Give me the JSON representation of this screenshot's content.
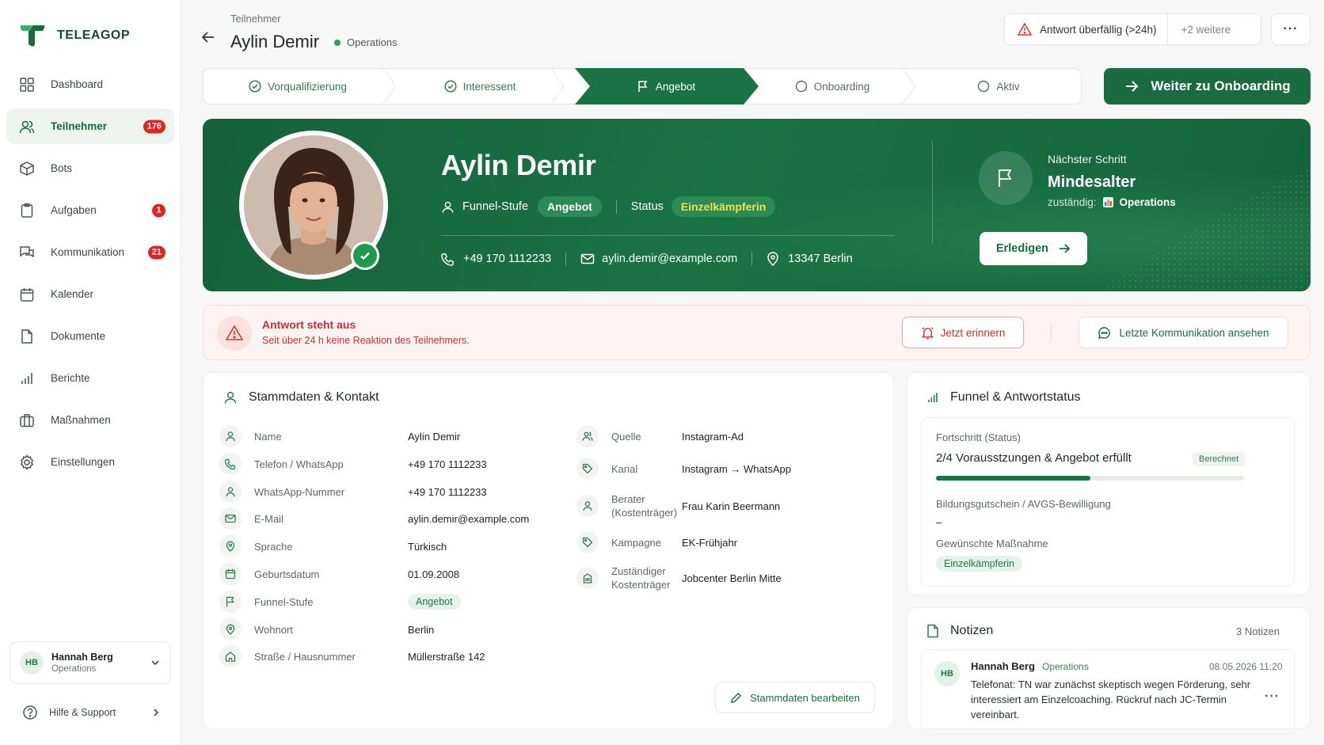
{
  "brand": {
    "name": "TELEAGOP"
  },
  "sidebar": {
    "items": [
      {
        "label": "Dashboard",
        "icon": "dashboard-icon"
      },
      {
        "label": "Teilnehmer",
        "icon": "users-icon",
        "badge": "176",
        "active": true
      },
      {
        "label": "Bots",
        "icon": "bot-icon"
      },
      {
        "label": "Aufgaben",
        "icon": "clipboard-icon",
        "badge": "1"
      },
      {
        "label": "Kommunikation",
        "icon": "chat-icon",
        "badge": "21"
      },
      {
        "label": "Kalender",
        "icon": "calendar-icon"
      },
      {
        "label": "Dokumente",
        "icon": "document-icon"
      },
      {
        "label": "Berichte",
        "icon": "bar-chart-icon"
      },
      {
        "label": "Maßnahmen",
        "icon": "briefcase-icon"
      },
      {
        "label": "Einstellungen",
        "icon": "gear-icon"
      }
    ],
    "user": {
      "initials": "HB",
      "name": "Hannah Berg",
      "role": "Operations"
    },
    "help": "Hilfe & Support"
  },
  "header": {
    "breadcrumb": "Teilnehmer",
    "title": "Aylin Demir",
    "team": "Operations",
    "alert": "Antwort überfällig (>24h)",
    "alert_more": "+2 weitere",
    "more": "···"
  },
  "steps": [
    {
      "label": "Vorqualifizierung",
      "state": "done"
    },
    {
      "label": "Interessent",
      "state": "done"
    },
    {
      "label": "Angebot",
      "state": "current"
    },
    {
      "label": "Onboarding",
      "state": "todo"
    },
    {
      "label": "Aktiv",
      "state": "todo"
    }
  ],
  "cta": "Weiter zu Onboarding",
  "hero": {
    "name": "Aylin Demir",
    "funnel_label": "Funnel-Stufe",
    "funnel_value": "Angebot",
    "status_label": "Status",
    "status_value": "Einzelkämpferin",
    "phone": "+49 170 1112233",
    "email": "aylin.demir@example.com",
    "location": "13347 Berlin",
    "next_label": "Nächster Schritt",
    "next_title": "Mindesalter",
    "resp_label": "zuständig:",
    "resp_value": "Operations",
    "done_btn": "Erledigen"
  },
  "warning": {
    "title": "Antwort steht aus",
    "subtitle": "Seit über 24 h keine Reaktion des Teilnehmers.",
    "remind": "Jetzt erinnern",
    "last_comm": "Letzte Kommunikation ansehen"
  },
  "stammdaten": {
    "title": "Stammdaten & Kontakt",
    "left": [
      {
        "label": "Name",
        "value": "Aylin Demir",
        "icon": "user-icon"
      },
      {
        "label": "Telefon / WhatsApp",
        "value": "+49 170 1112233",
        "icon": "phone-icon"
      },
      {
        "label": "WhatsApp-Nummer",
        "value": "+49 170 1112233",
        "icon": "user-icon"
      },
      {
        "label": "E-Mail",
        "value": "aylin.demir@example.com",
        "icon": "mail-icon"
      },
      {
        "label": "Sprache",
        "value": "Türkisch",
        "icon": "pin-icon"
      },
      {
        "label": "Geburtsdatum",
        "value": "01.09.2008",
        "icon": "calendar-icon"
      },
      {
        "label": "Funnel-Stufe",
        "value": "Angebot",
        "icon": "flag-icon",
        "pill": true
      },
      {
        "label": "Wohnort",
        "value": "Berlin",
        "icon": "pin-icon"
      },
      {
        "label": "Straße / Hausnummer",
        "value": "Müllerstraße 142",
        "icon": "home-icon"
      }
    ],
    "right": [
      {
        "label": "Quelle",
        "value": "Instagram-Ad",
        "icon": "users-icon"
      },
      {
        "label": "Kanal",
        "value": "Instagram → WhatsApp",
        "icon": "tag-icon"
      },
      {
        "label": "Berater (Kostenträger)",
        "value": "Frau Karin Beermann",
        "icon": "user-icon"
      },
      {
        "label": "Kampagne",
        "value": "EK-Frühjahr",
        "icon": "tag-icon"
      },
      {
        "label": "Zuständiger Kostenträger",
        "value": "Jobcenter Berlin Mitte",
        "icon": "building-icon"
      }
    ],
    "edit_btn": "Stammdaten bearbeiten"
  },
  "funnel": {
    "title": "Funnel & Antwortstatus",
    "progress_label": "Fortschritt (Status)",
    "progress_value": "2/4 Vorausstzungen & Angebot erfüllt",
    "progress_fraction": 0.5,
    "badge": "Berechnet",
    "voucher_label": "Bildungsgutschein / AVGS-Bewilligung",
    "voucher_value": "–",
    "measure_label": "Gewünschte Maßnahme",
    "measure_value": "Einzelkämpferin"
  },
  "notes": {
    "title": "Notizen",
    "count": "3 Notizen",
    "items": [
      {
        "initials": "HB",
        "author": "Hannah Berg",
        "team": "Operations",
        "date": "08.05.2026 11:20",
        "text": "Telefonat: TN war zunächst skeptisch wegen Förderung, sehr interessiert am Einzelcoaching. Rückruf nach JC-Termin vereinbart."
      }
    ]
  },
  "colors": {
    "brand": "#1a6b3f",
    "accent": "#22a55a",
    "danger": "#c53030",
    "warning_bg": "#fdf3f2"
  }
}
